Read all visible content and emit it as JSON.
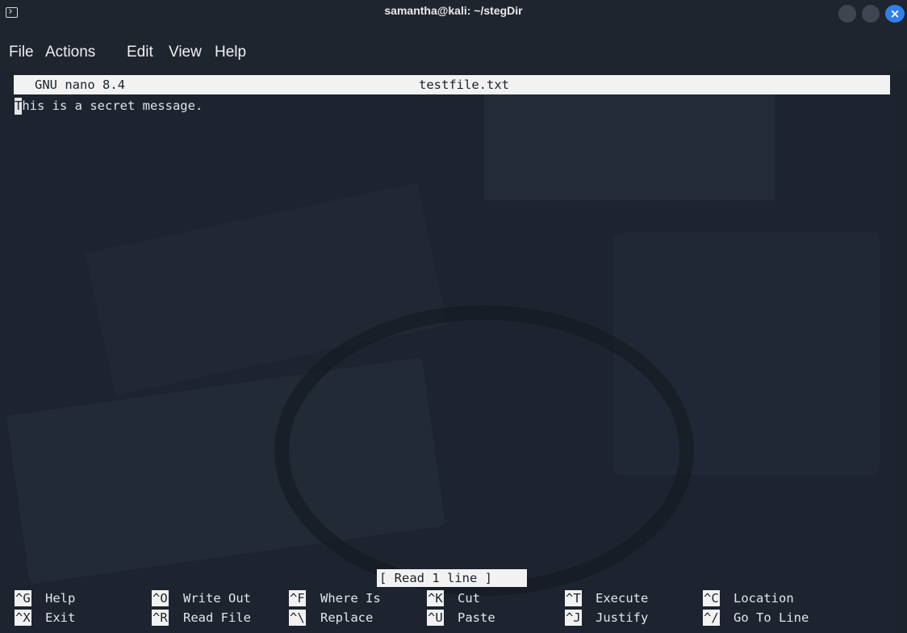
{
  "window": {
    "title": "samantha@kali: ~/stegDir",
    "icon": "terminal-icon",
    "controls": [
      "minimize",
      "maximize",
      "close"
    ],
    "accent_color": "#2f80ed"
  },
  "menu": {
    "items": [
      "File",
      "Actions",
      "Edit",
      "View",
      "Help"
    ]
  },
  "nano": {
    "version": "GNU nano 8.4",
    "filename": "testfile.txt",
    "content_first_char": "T",
    "content_rest": "his is a secret message.",
    "status": "[ Read 1 line ]"
  },
  "shortcuts": {
    "row1": [
      {
        "key": "^G",
        "label": "Help"
      },
      {
        "key": "^O",
        "label": "Write Out"
      },
      {
        "key": "^F",
        "label": "Where Is"
      },
      {
        "key": "^K",
        "label": "Cut"
      },
      {
        "key": "^T",
        "label": "Execute"
      },
      {
        "key": "^C",
        "label": "Location"
      }
    ],
    "row2": [
      {
        "key": "^X",
        "label": "Exit"
      },
      {
        "key": "^R",
        "label": "Read File"
      },
      {
        "key": "^\\",
        "label": "Replace"
      },
      {
        "key": "^U",
        "label": "Paste"
      },
      {
        "key": "^J",
        "label": "Justify"
      },
      {
        "key": "^/",
        "label": "Go To Line"
      }
    ]
  }
}
